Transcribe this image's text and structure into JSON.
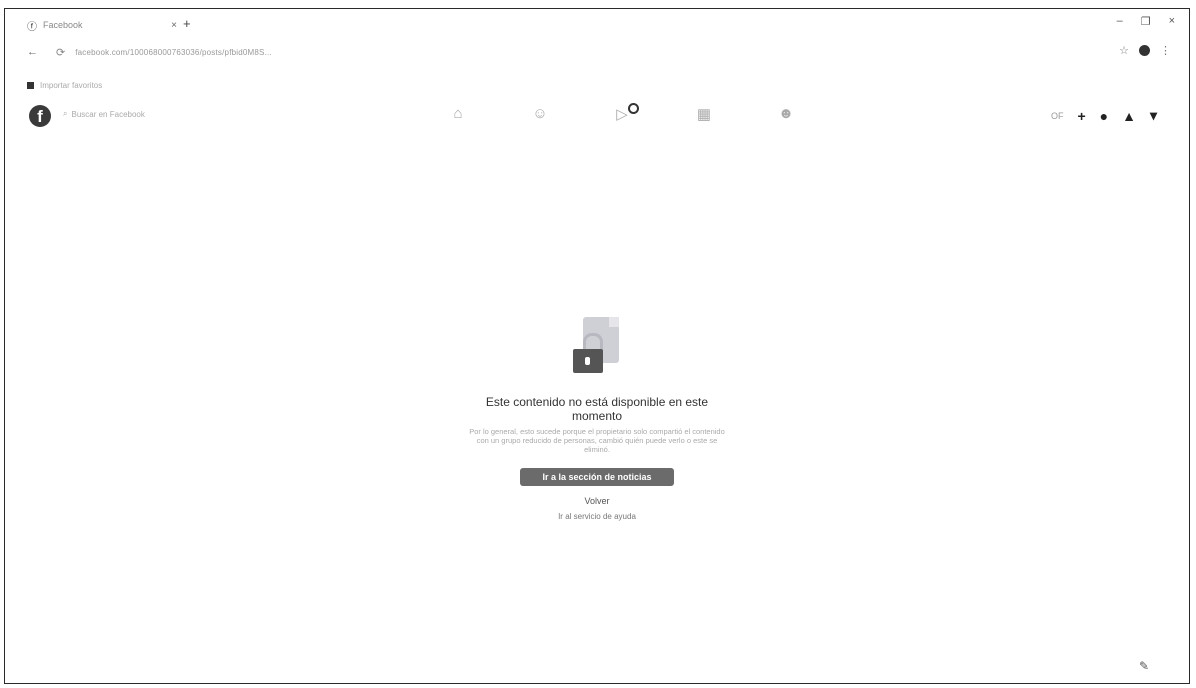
{
  "browser": {
    "tab_title": "Facebook",
    "new_tab": "+",
    "tab_close": "×",
    "window_controls": [
      "–",
      "❐",
      "×"
    ],
    "url": "facebook.com/100068000763036/posts/pfbid0M8S..."
  },
  "bookmarks": {
    "items": [
      "Importar favoritos"
    ]
  },
  "fb": {
    "search_placeholder": "Buscar en Facebook",
    "right_text": "OF"
  },
  "error": {
    "title_line1": "Este contenido no está disponible en este",
    "title_line2": "momento",
    "description": "Por lo general, esto sucede porque el propietario solo compartió el contenido con un grupo reducido de personas, cambió quién puede verlo o este se eliminó.",
    "primary_button": "Ir a la sección de noticias",
    "back_link": "Volver",
    "help_link": "Ir al servicio de ayuda"
  }
}
